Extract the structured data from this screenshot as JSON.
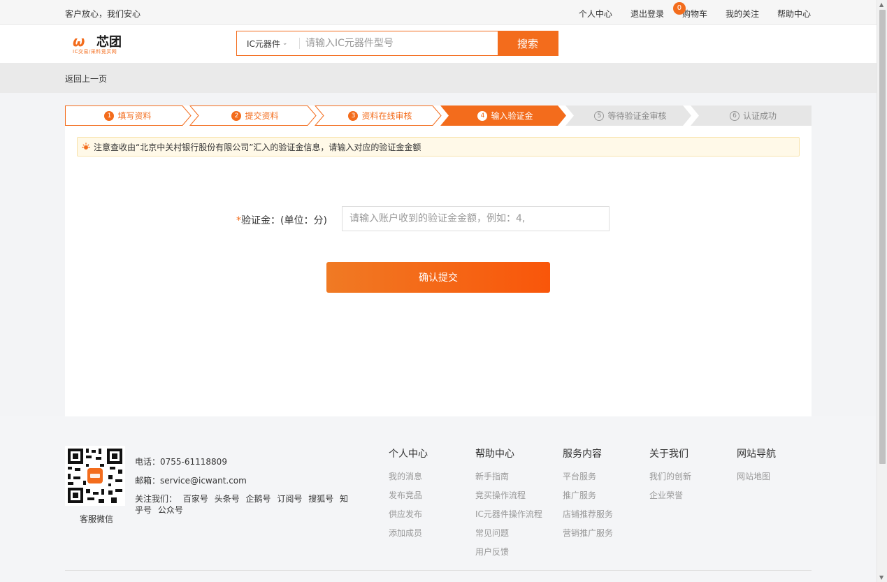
{
  "topbar": {
    "slogan": "客户放心，我们安心",
    "nav": [
      "个人中心",
      "退出登录",
      "购物车",
      "我的关注",
      "帮助中心"
    ],
    "cart_count": "0"
  },
  "header": {
    "logo_mark": "ω",
    "logo_name": "芯团",
    "logo_tag": "IC交易/采料竞买网",
    "search_category": "IC元器件",
    "search_placeholder": "请输入IC元器件型号",
    "search_button": "搜索"
  },
  "crumb": "返回上一页",
  "steps": [
    {
      "num": "1",
      "label": "填写资料",
      "state": "done"
    },
    {
      "num": "2",
      "label": "提交资料",
      "state": "done"
    },
    {
      "num": "3",
      "label": "资料在线审核",
      "state": "done"
    },
    {
      "num": "4",
      "label": "输入验证金",
      "state": "active"
    },
    {
      "num": "5",
      "label": "等待验证金审核",
      "state": "todo"
    },
    {
      "num": "6",
      "label": "认证成功",
      "state": "todo"
    }
  ],
  "notice": "注意查收由“北京中关村银行股份有限公司”汇入的验证金信息，请输入对应的验证金金额",
  "form": {
    "required_mark": "*",
    "label": "验证金：(单位：分)",
    "placeholder": "请输入账户收到的验证金金额，例如：4,",
    "submit": "确认提交"
  },
  "footer": {
    "phone": "电话：0755-61118809",
    "email": "邮箱：service@icwant.com",
    "follow_label": "关注我们：",
    "follow_items": [
      "百家号",
      "头条号",
      "企鹅号",
      "订阅号",
      "搜狐号",
      "知乎号",
      "公众号"
    ],
    "qr_label": "客服微信",
    "columns": [
      {
        "title": "个人中心",
        "items": [
          "我的消息",
          "发布竞品",
          "供应发布",
          "添加成员"
        ]
      },
      {
        "title": "帮助中心",
        "items": [
          "新手指南",
          "竞买操作流程",
          "IC元器件操作流程",
          "常见问题",
          "用户反馈"
        ]
      },
      {
        "title": "服务内容",
        "items": [
          "平台服务",
          "推广服务",
          "店铺推荐服务",
          "营销推广服务"
        ]
      },
      {
        "title": "关于我们",
        "items": [
          "我们的创新",
          "企业荣誉"
        ]
      },
      {
        "title": "网站导航",
        "items": [
          "网站地图"
        ]
      }
    ]
  },
  "colors": {
    "accent": "#f36c1c",
    "step_todo": "#e6e6e6"
  }
}
